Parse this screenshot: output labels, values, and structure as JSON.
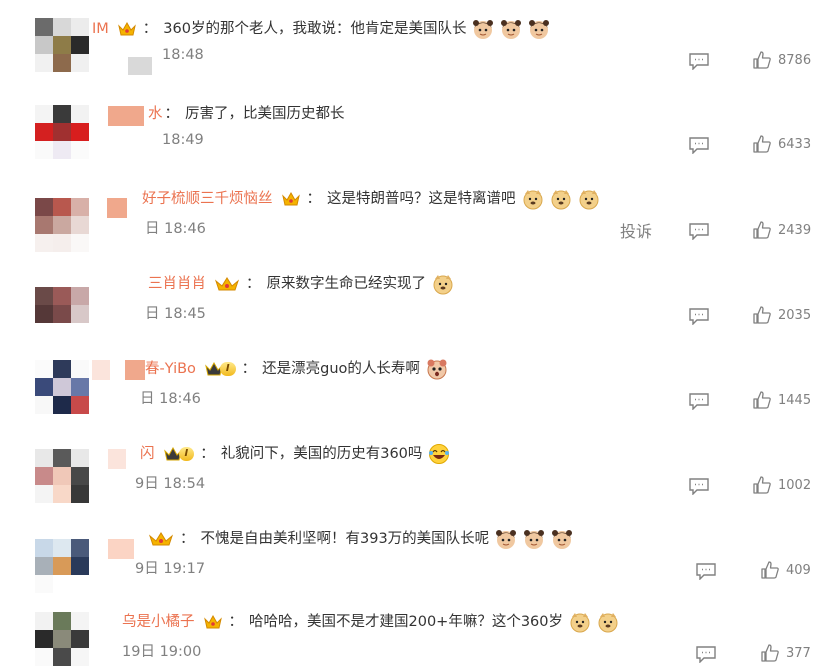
{
  "comments": [
    {
      "name": "IM",
      "text": "360岁的那个老人，我敢说：他肯定是美国队长",
      "time": "18:48",
      "likes": "8786",
      "badge": "crown",
      "emoji": "captain-face",
      "emoji_count": 3
    },
    {
      "name": "水",
      "text": "厉害了，比美国历史都长",
      "time": "18:49",
      "likes": "6433",
      "badge": "none",
      "emoji": "",
      "emoji_count": 0
    },
    {
      "name": "好子梳顺三千烦恼丝",
      "text": "这是特朗普吗？这是特离谱吧",
      "time": "18:46",
      "likes": "2439",
      "badge": "crown",
      "emoji": "doge-face",
      "emoji_count": 3
    },
    {
      "name": "三肖肖肖",
      "text": "原来数字生命已经实现了",
      "time": "18:45",
      "likes": "2035",
      "badge": "crown",
      "emoji": "doge-face",
      "emoji_count": 1
    },
    {
      "name": "春-YiBo",
      "text": "还是漂亮guo的人长寿啊",
      "time": "18:46",
      "likes": "1445",
      "badge": "vip",
      "emoji": "shocked-face",
      "emoji_count": 1
    },
    {
      "name": "闪",
      "text": "礼貌问下，美国的历史有360吗",
      "time": "18:54",
      "likes": "1002",
      "badge": "vip",
      "emoji": "laughing-face",
      "emoji_count": 1
    },
    {
      "name": "",
      "text": "不愧是自由美利坚啊！有393万的美国队长呢",
      "time": "19:17",
      "likes": "409",
      "badge": "crown",
      "emoji": "captain-face",
      "emoji_count": 3
    },
    {
      "name": "乌是小橘子",
      "text": "哈哈哈，美国不是才建国200+年嘛？这个360岁",
      "time": "19:00",
      "likes": "377",
      "badge": "crown",
      "emoji": "doge-face",
      "emoji_count": 2
    }
  ],
  "time_prefixes": [
    "",
    "",
    "日",
    "日",
    "日",
    "9日",
    "9日",
    "19日"
  ],
  "report_label": "投诉",
  "vip_level": "I",
  "colors": {
    "username": "#eb7350",
    "meta": "#808080",
    "text": "#333333"
  }
}
